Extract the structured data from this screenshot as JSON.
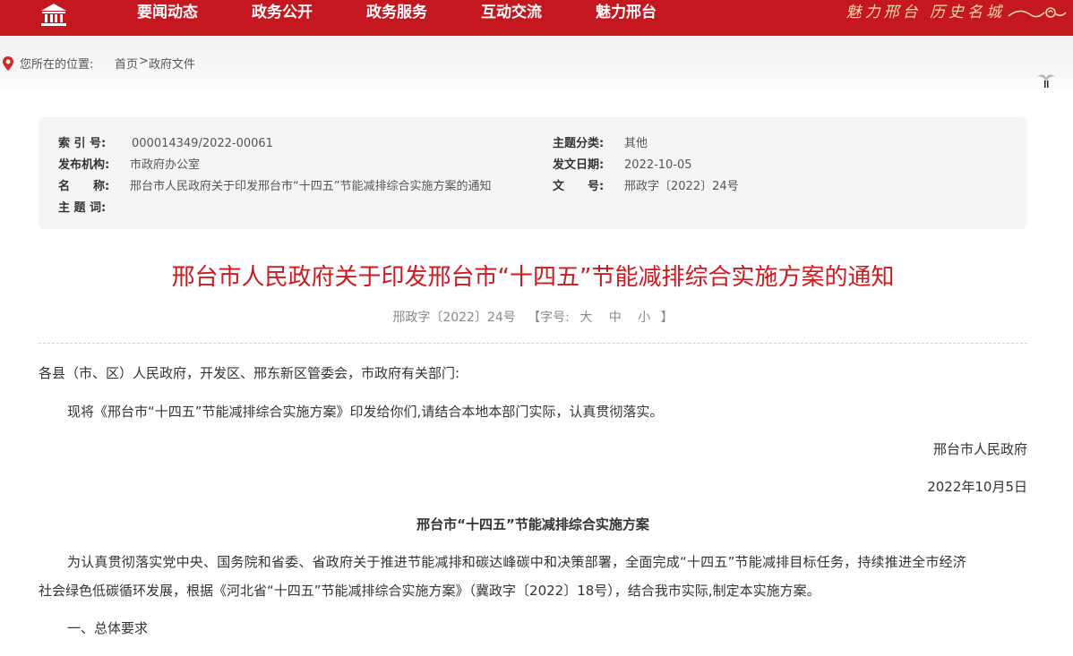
{
  "nav": {
    "items": [
      "要闻动态",
      "政务公开",
      "政务服务",
      "互动交流",
      "魅力邢台"
    ],
    "slogan": "魅力邢台 历史名城"
  },
  "breadcrumb": {
    "label": "您所在的位置:",
    "home": "首页",
    "sep": ">",
    "current": "政府文件"
  },
  "info": {
    "index_k": "索 引 号:",
    "index_v": "000014349/2022-00061",
    "org_k": "发布机构:",
    "org_v": "市政府办公室",
    "name_k": "名　　称:",
    "name_v": "邢台市人民政府关于印发邢台市“十四五”节能减排综合实施方案的通知",
    "keyword_k": "主 题 词:",
    "keyword_v": "",
    "category_k": "主题分类:",
    "category_v": "其他",
    "date_k": "发文日期:",
    "date_v": "2022-10-05",
    "docno_k": "文　　号:",
    "docno_v": "邢政字〔2022〕24号"
  },
  "doc": {
    "title": "邢台市人民政府关于印发邢台市“十四五”节能减排综合实施方案的通知",
    "sub_docno": "邢政字〔2022〕24号",
    "font_label": "【字号:",
    "font_large": "大",
    "font_mid": "中",
    "font_small": "小",
    "font_close": "】",
    "salutation": "各县（市、区）人民政府，开发区、邢东新区管委会，市政府有关部门:",
    "para1": "现将《邢台市“十四五”节能减排综合实施方案》印发给你们,请结合本地本部门实际，认真贯彻落实。",
    "signer": "邢台市人民政府",
    "date": "2022年10月5日",
    "plan_title": "邢台市“十四五”节能减排综合实施方案",
    "para2_line1": "为认真贯彻落实党中央、国务院和省委、省政府关于推进节能减排和碳达峰碳中和决策部署，全面完成“十四五”节能减排目标任务，持续推进全市经济",
    "para2_line2": "社会绿色低碳循环发展，根据《河北省“十四五”节能减排综合实施方案》（冀政字〔2022〕18号），结合我市实际,制定本实施方案。",
    "section1": "一、总体要求"
  },
  "colors": {
    "nav_red": "#c4171f",
    "title_red": "#d0191f",
    "slogan_gold": "#f3d9a4"
  },
  "icons": [
    "home-icon",
    "location-pin-icon",
    "bird-icon",
    "cloud-ornament-icon"
  ]
}
